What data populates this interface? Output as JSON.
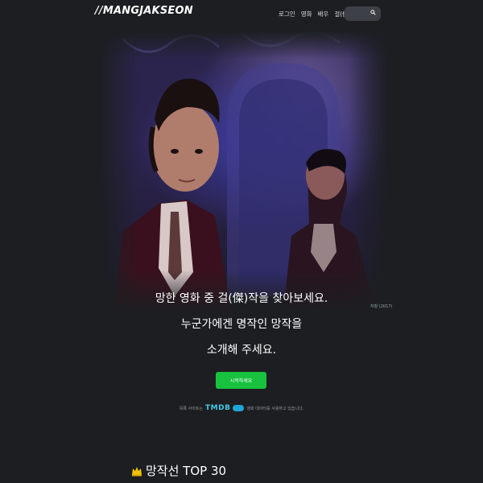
{
  "header": {
    "logo_prefix": "//",
    "logo_text": "MANGJAKSEON",
    "nav": [
      "로그인",
      "영화",
      "배우",
      "걸(傑)작선"
    ]
  },
  "hero": {
    "credit": "지팡 (2017)"
  },
  "tagline": {
    "line1": "망한 영화 중 걸(傑)작을 찾아보세요.",
    "line2": "누군가에겐 명작인 망작을",
    "line3": "소개해 주세요."
  },
  "start_button": "시작하세요",
  "tmdb": {
    "prefix": "목록 사이트는",
    "logo": "TMDB",
    "suffix": "영화 데이터를 사용하고 있습니다."
  },
  "section": {
    "title": "망작선 TOP 30"
  },
  "colors": {
    "background": "#1c1e21",
    "accent_green": "#18c23e",
    "tmdb_blue": "#45c8e6"
  }
}
